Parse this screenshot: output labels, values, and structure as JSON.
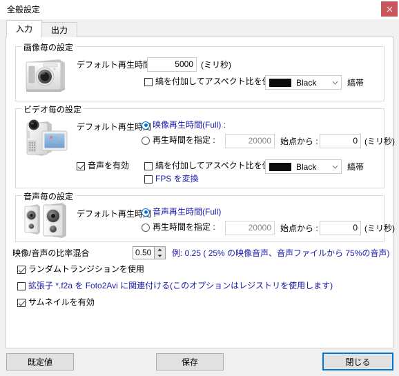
{
  "window": {
    "title": "全般設定",
    "close_icon": "close-icon"
  },
  "tabs": [
    {
      "label": "入力",
      "active": true
    },
    {
      "label": "出力",
      "active": false
    }
  ],
  "image_group": {
    "title": "画像毎の設定",
    "icon": "photo-camera-icon",
    "duration_label": "デフォルト再生時間 :",
    "duration_value": "5000",
    "duration_unit": "(ミリ秒)",
    "aspect_checkbox": {
      "label": "縞を付加してアスペクト比を保持",
      "checked": false
    },
    "color_combo": {
      "value": "Black",
      "swatch": "#0d0d0d"
    },
    "color_suffix": "縞帯"
  },
  "video_group": {
    "title": "ビデオ毎の設定",
    "icon": "camcorder-icon",
    "duration_label": "デフォルト再生時間",
    "radio_full": {
      "label": "映像再生時間(Full) :",
      "selected": true
    },
    "radio_custom": {
      "label": "再生時間を指定 :",
      "selected": false
    },
    "custom_value": "20000",
    "start_label": "始点から :",
    "start_value": "0",
    "unit": "(ミリ秒)",
    "audio_checkbox": {
      "label": "音声を有効",
      "checked": true
    },
    "aspect_checkbox": {
      "label": "縞を付加してアスペクト比を保持",
      "checked": false
    },
    "fps_checkbox": {
      "label": "FPS を変換",
      "checked": false
    },
    "color_combo": {
      "value": "Black",
      "swatch": "#0d0d0d"
    },
    "color_suffix": "縞帯"
  },
  "audio_group": {
    "title": "音声毎の設定",
    "icon": "speakers-icon",
    "duration_label": "デフォルト再生時間 :",
    "radio_full": {
      "label": "音声再生時間(Full)",
      "selected": true
    },
    "radio_custom": {
      "label": "再生時間を指定 :",
      "selected": false
    },
    "custom_value": "20000",
    "start_label": "始点から :",
    "start_value": "0",
    "unit": "(ミリ秒)"
  },
  "options": {
    "mix_label": "映像/音声の比率混合",
    "mix_value": "0.50",
    "mix_hint": "例: 0.25 ( 25% の映像音声、音声ファイルから 75%の音声)",
    "random_transition": {
      "label": "ランダムトランジションを使用",
      "checked": true
    },
    "associate_f2a": {
      "label": "拡張子 *.f2a を Foto2Avi に関連付ける(このオプションはレジストリを使用します)",
      "checked": false
    },
    "thumbnails": {
      "label": "サムネイルを有効",
      "checked": true
    }
  },
  "buttons": {
    "defaults": "既定値",
    "save": "保存",
    "close": "閉じる"
  }
}
